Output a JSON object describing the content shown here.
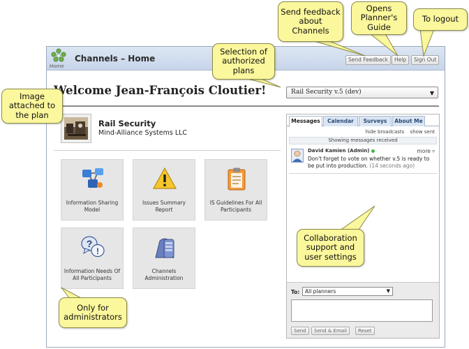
{
  "app": {
    "title": "Channels – Home",
    "logo_caption": "Home"
  },
  "header_buttons": {
    "feedback": "Send Feedback",
    "help": "Help",
    "signout": "Sign Out"
  },
  "welcome": "Welcome Jean-François Cloutier!",
  "plan_select": {
    "value": "Rail Security v.5 (dev)"
  },
  "plan": {
    "name": "Rail Security",
    "org": "Mind-Alliance Systems LLC"
  },
  "tiles": [
    {
      "label": "Information Sharing Model",
      "icon": "network-icon"
    },
    {
      "label": "Issues Summary Report",
      "icon": "warning-icon"
    },
    {
      "label": "IS Guidelines For All Participants",
      "icon": "clipboard-icon"
    },
    {
      "label": "Information Needs Of All Participants",
      "icon": "question-bubbles-icon"
    },
    {
      "label": "Channels Administration",
      "icon": "admin-icon"
    }
  ],
  "panel": {
    "tabs": [
      "Messages",
      "Calendar",
      "Surveys",
      "About Me"
    ],
    "active_tab": "Messages",
    "links": {
      "hide": "hide broadcasts",
      "show": "show sent"
    },
    "showing": "Showing messages received",
    "message": {
      "sender": "David Kamien (Admin)",
      "more": "more ▿",
      "text": "Don't forget to vote on whether v.5 is ready to be put into production.",
      "ago": "(14 seconds ago)"
    },
    "compose": {
      "to_label": "To:",
      "to_value": "All planners",
      "send": "Send",
      "send_email": "Send & Email",
      "reset": "Reset"
    }
  },
  "callouts": {
    "feedback": "Send feedback\nabout\nChannels",
    "guide": "Opens\nPlanner's\nGuide",
    "logout": "To logout",
    "plans": "Selection of\nauthorized\nplans",
    "image": "Image\nattached to\nthe plan",
    "collab": "Collaboration\nsupport and\nuser settings",
    "admins": "Only for\nadministrators"
  },
  "colors": {
    "callout_fill": "#fbf79c",
    "header_blue": "#c7d5ea",
    "tab_blue": "#dbe5f3",
    "online_green": "#3fb83f"
  }
}
